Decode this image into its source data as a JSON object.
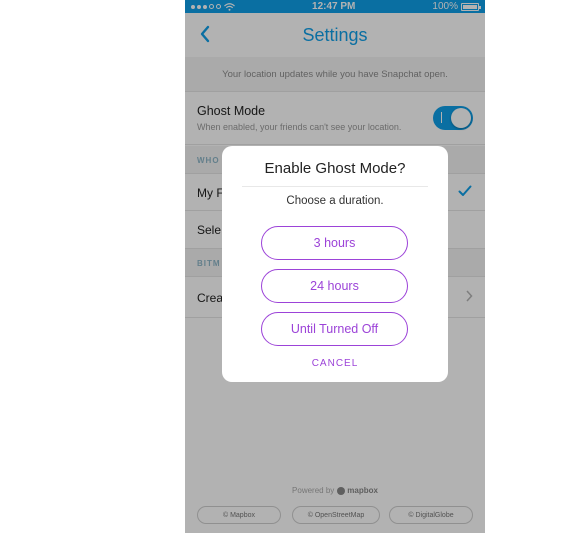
{
  "status_bar": {
    "time": "12:47 PM",
    "battery": "100%",
    "wifi_icon": "wifi-icon",
    "battery_icon": "battery-icon"
  },
  "header": {
    "title": "Settings",
    "back_icon": "chevron-left-icon"
  },
  "info_text": "Your location updates while you have Snapchat open.",
  "ghost_mode": {
    "title": "Ghost Mode",
    "subtitle": "When enabled, your friends can't see your location.",
    "enabled": true
  },
  "sections": [
    {
      "header": "WHO",
      "rows": [
        {
          "label": "My F",
          "selected": true
        },
        {
          "label": "Sele",
          "selected": false
        }
      ]
    },
    {
      "header": "BITM",
      "rows": [
        {
          "label": "Crea",
          "chevron": true
        }
      ]
    }
  ],
  "footer": {
    "powered_by": "Powered by",
    "brand": "mapbox",
    "attributions": [
      "© Mapbox",
      "© OpenStreetMap",
      "© DigitalGlobe"
    ]
  },
  "dialog": {
    "title": "Enable Ghost Mode?",
    "subtitle": "Choose a duration.",
    "options": [
      "3 hours",
      "24 hours",
      "Until Turned Off"
    ],
    "cancel_label": "CANCEL"
  },
  "colors": {
    "accent_blue": "#0f9fe8",
    "accent_purple": "#9c43d8"
  }
}
